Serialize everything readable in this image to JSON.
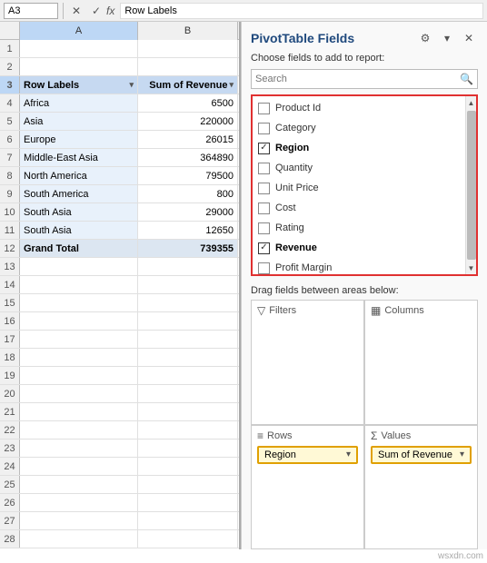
{
  "formulaBar": {
    "cellRef": "A3",
    "value": "Row Labels",
    "cancelIcon": "✕",
    "confirmIcon": "✓",
    "fxLabel": "fx"
  },
  "spreadsheet": {
    "columns": [
      "A",
      "B"
    ],
    "rows": [
      {
        "num": 1,
        "a": "",
        "b": ""
      },
      {
        "num": 2,
        "a": "",
        "b": ""
      },
      {
        "num": 3,
        "a": "Row Labels",
        "b": "Sum of Revenue",
        "type": "header"
      },
      {
        "num": 4,
        "a": "Africa",
        "b": "6500"
      },
      {
        "num": 5,
        "a": "Asia",
        "b": "220000"
      },
      {
        "num": 6,
        "a": "Europe",
        "b": "26015"
      },
      {
        "num": 7,
        "a": "Middle-East Asia",
        "b": "364890"
      },
      {
        "num": 8,
        "a": "North America",
        "b": "79500"
      },
      {
        "num": 9,
        "a": "South America",
        "b": "800"
      },
      {
        "num": 10,
        "a": "South Asia",
        "b": "29000"
      },
      {
        "num": 11,
        "a": "South Asia",
        "b": "12650"
      },
      {
        "num": 12,
        "a": "Grand Total",
        "b": "739355",
        "type": "total"
      },
      {
        "num": 13,
        "a": "",
        "b": ""
      },
      {
        "num": 14,
        "a": "",
        "b": ""
      },
      {
        "num": 15,
        "a": "",
        "b": ""
      },
      {
        "num": 16,
        "a": "",
        "b": ""
      },
      {
        "num": 17,
        "a": "",
        "b": ""
      },
      {
        "num": 18,
        "a": "",
        "b": ""
      },
      {
        "num": 19,
        "a": "",
        "b": ""
      },
      {
        "num": 20,
        "a": "",
        "b": ""
      },
      {
        "num": 21,
        "a": "",
        "b": ""
      },
      {
        "num": 22,
        "a": "",
        "b": ""
      },
      {
        "num": 23,
        "a": "",
        "b": ""
      },
      {
        "num": 24,
        "a": "",
        "b": ""
      },
      {
        "num": 25,
        "a": "",
        "b": ""
      },
      {
        "num": 26,
        "a": "",
        "b": ""
      },
      {
        "num": 27,
        "a": "",
        "b": ""
      },
      {
        "num": 28,
        "a": "",
        "b": ""
      }
    ]
  },
  "pivotPanel": {
    "title": "PivotTable Fields",
    "subtitle": "Choose fields to add to report:",
    "searchPlaceholder": "Search",
    "fields": [
      {
        "id": "product_id",
        "label": "Product Id",
        "checked": false
      },
      {
        "id": "category",
        "label": "Category",
        "checked": false
      },
      {
        "id": "region",
        "label": "Region",
        "checked": true,
        "bold": true
      },
      {
        "id": "quantity",
        "label": "Quantity",
        "checked": false
      },
      {
        "id": "unit_price",
        "label": "Unit Price",
        "checked": false
      },
      {
        "id": "cost",
        "label": "Cost",
        "checked": false
      },
      {
        "id": "rating",
        "label": "Rating",
        "checked": false
      },
      {
        "id": "revenue",
        "label": "Revenue",
        "checked": true,
        "bold": true
      },
      {
        "id": "profit_margin",
        "label": "Profit Margin",
        "checked": false
      }
    ],
    "dragLabel": "Drag fields between areas below:",
    "areas": {
      "filters": {
        "icon": "▼",
        "label": "Filters"
      },
      "columns": {
        "icon": "|||",
        "label": "Columns"
      },
      "rows": {
        "icon": "≡",
        "label": "Rows",
        "item": "Region"
      },
      "values": {
        "icon": "Σ",
        "label": "Values",
        "item": "Sum of Revenue"
      }
    }
  },
  "watermark": "wsxdn.com"
}
